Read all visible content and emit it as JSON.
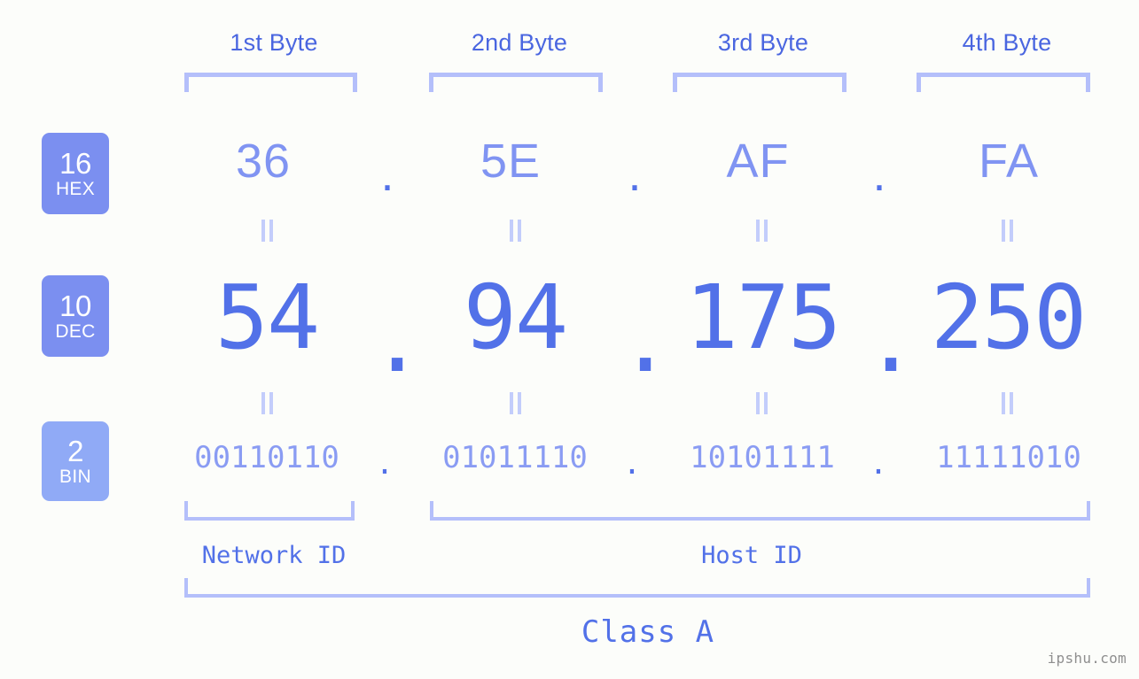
{
  "background": "#fcfdfa",
  "colors": {
    "accent": "#5271e8",
    "accent_light": "#8094f2",
    "bracket": "#b4bffa",
    "badge": "#7b8ff0",
    "badge_bin": "#90aaf6",
    "watermark": "#8f8f8f"
  },
  "headers": [
    {
      "label": "1st Byte"
    },
    {
      "label": "2nd Byte"
    },
    {
      "label": "3rd Byte"
    },
    {
      "label": "4th Byte"
    }
  ],
  "radix_badges": [
    {
      "base": "16",
      "name": "HEX"
    },
    {
      "base": "10",
      "name": "DEC"
    },
    {
      "base": "2",
      "name": "BIN"
    }
  ],
  "rows": {
    "hex": {
      "base": "16",
      "name": "HEX",
      "values": [
        "36",
        "5E",
        "AF",
        "FA"
      ],
      "separator": "."
    },
    "dec": {
      "base": "10",
      "name": "DEC",
      "values": [
        "54",
        "94",
        "175",
        "250"
      ],
      "separator": "."
    },
    "bin": {
      "base": "2",
      "name": "BIN",
      "values": [
        "00110110",
        "01011110",
        "10101111",
        "11111010"
      ],
      "separator": "."
    }
  },
  "equals_symbol": "=",
  "id_regions": [
    {
      "label": "Network ID"
    },
    {
      "label": "Host ID"
    }
  ],
  "class_label": "Class A",
  "watermark": "ipshu.com"
}
